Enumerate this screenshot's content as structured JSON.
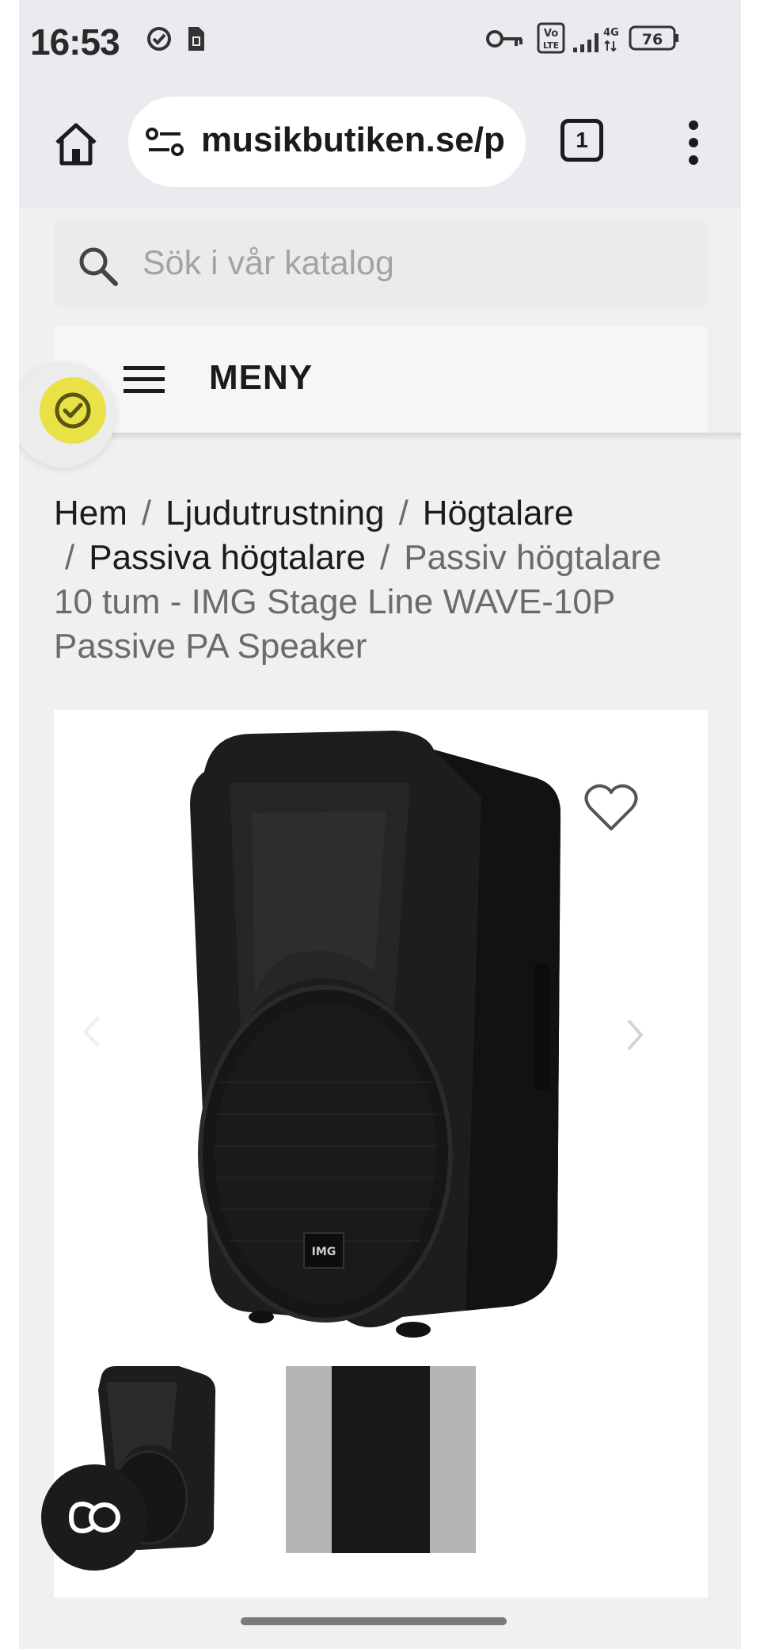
{
  "status_bar": {
    "time": "16:53",
    "network": "4G",
    "volte": "Vo LTE",
    "battery": "76",
    "icons": [
      "check-circle-icon",
      "sim-icon",
      "key-icon",
      "volte-icon",
      "signal-icon",
      "battery-icon"
    ]
  },
  "browser": {
    "url": "musikbutiken.se/p",
    "tab_count": "1",
    "icons": [
      "home-icon",
      "site-settings-icon",
      "tabs-icon",
      "more-vert-icon"
    ]
  },
  "search": {
    "placeholder": "Sök i vår katalog"
  },
  "menu": {
    "label": "MENY"
  },
  "breadcrumb": {
    "items": [
      "Hem",
      "Ljudutrustning",
      "Högtalare",
      "Passiva högtalare"
    ],
    "separator": "/",
    "current": "Passiv högtalare 10 tum - IMG Stage Line WAVE-10P Passive PA Speaker"
  },
  "product": {
    "brand_mark": "IMG",
    "thumbnails": [
      "speaker-front-thumb",
      "speaker-back-thumb"
    ]
  },
  "colors": {
    "badge": "#e9e247",
    "chat_button": "#1b1b1b",
    "page_bg": "#f0f0f0",
    "browser_bar": "#e9ebee"
  }
}
